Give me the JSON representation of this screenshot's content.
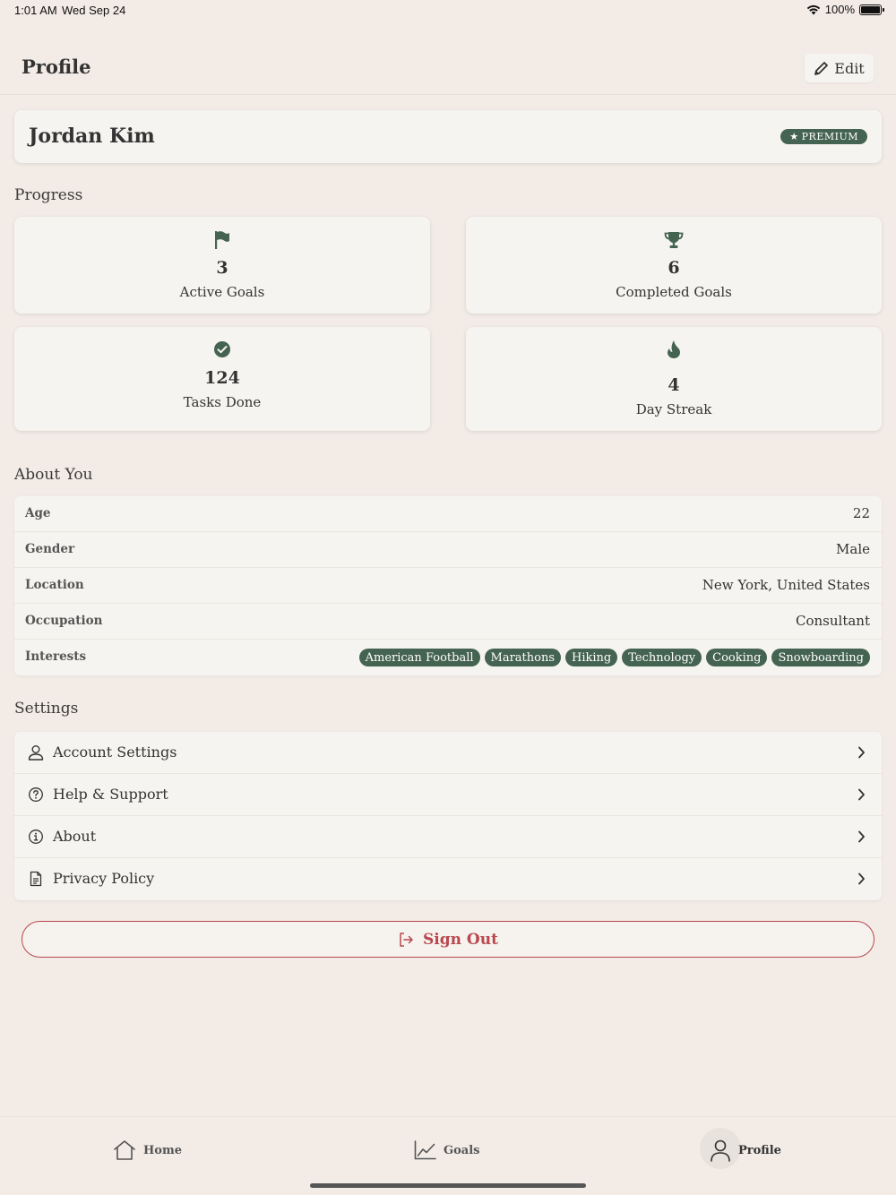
{
  "status_bar": {
    "time": "1:01 AM",
    "date": "Wed Sep 24",
    "battery": "100%"
  },
  "header": {
    "title": "Profile",
    "edit_label": "Edit"
  },
  "user": {
    "name": "Jordan Kim",
    "badge": "PREMIUM"
  },
  "progress": {
    "title": "Progress",
    "stats": [
      {
        "icon": "flag-icon",
        "value": "3",
        "label": "Active Goals"
      },
      {
        "icon": "trophy-icon",
        "value": "6",
        "label": "Completed Goals"
      },
      {
        "icon": "check-circle-icon",
        "value": "124",
        "label": "Tasks Done"
      },
      {
        "icon": "flame-icon",
        "value": "4",
        "label": "Day Streak"
      }
    ]
  },
  "about": {
    "title": "About You",
    "rows": [
      {
        "key": "Age",
        "value": "22"
      },
      {
        "key": "Gender",
        "value": "Male"
      },
      {
        "key": "Location",
        "value": "New York, United States"
      },
      {
        "key": "Occupation",
        "value": "Consultant"
      }
    ],
    "interests_label": "Interests",
    "interests": [
      "American Football",
      "Marathons",
      "Hiking",
      "Technology",
      "Cooking",
      "Snowboarding"
    ]
  },
  "settings": {
    "title": "Settings",
    "items": [
      {
        "icon": "user-icon",
        "label": "Account Settings"
      },
      {
        "icon": "help-icon",
        "label": "Help & Support"
      },
      {
        "icon": "info-icon",
        "label": "About"
      },
      {
        "icon": "document-icon",
        "label": "Privacy Policy"
      }
    ]
  },
  "sign_out": {
    "label": "Sign Out"
  },
  "tabbar": {
    "items": [
      {
        "icon": "home-icon",
        "label": "Home"
      },
      {
        "icon": "chart-icon",
        "label": "Goals"
      },
      {
        "icon": "user-icon",
        "label": "Profile",
        "active": true
      }
    ]
  },
  "colors": {
    "accent": "#456351",
    "danger": "#b8484e",
    "background": "#f2ebe6",
    "card": "#f6f4f0"
  }
}
